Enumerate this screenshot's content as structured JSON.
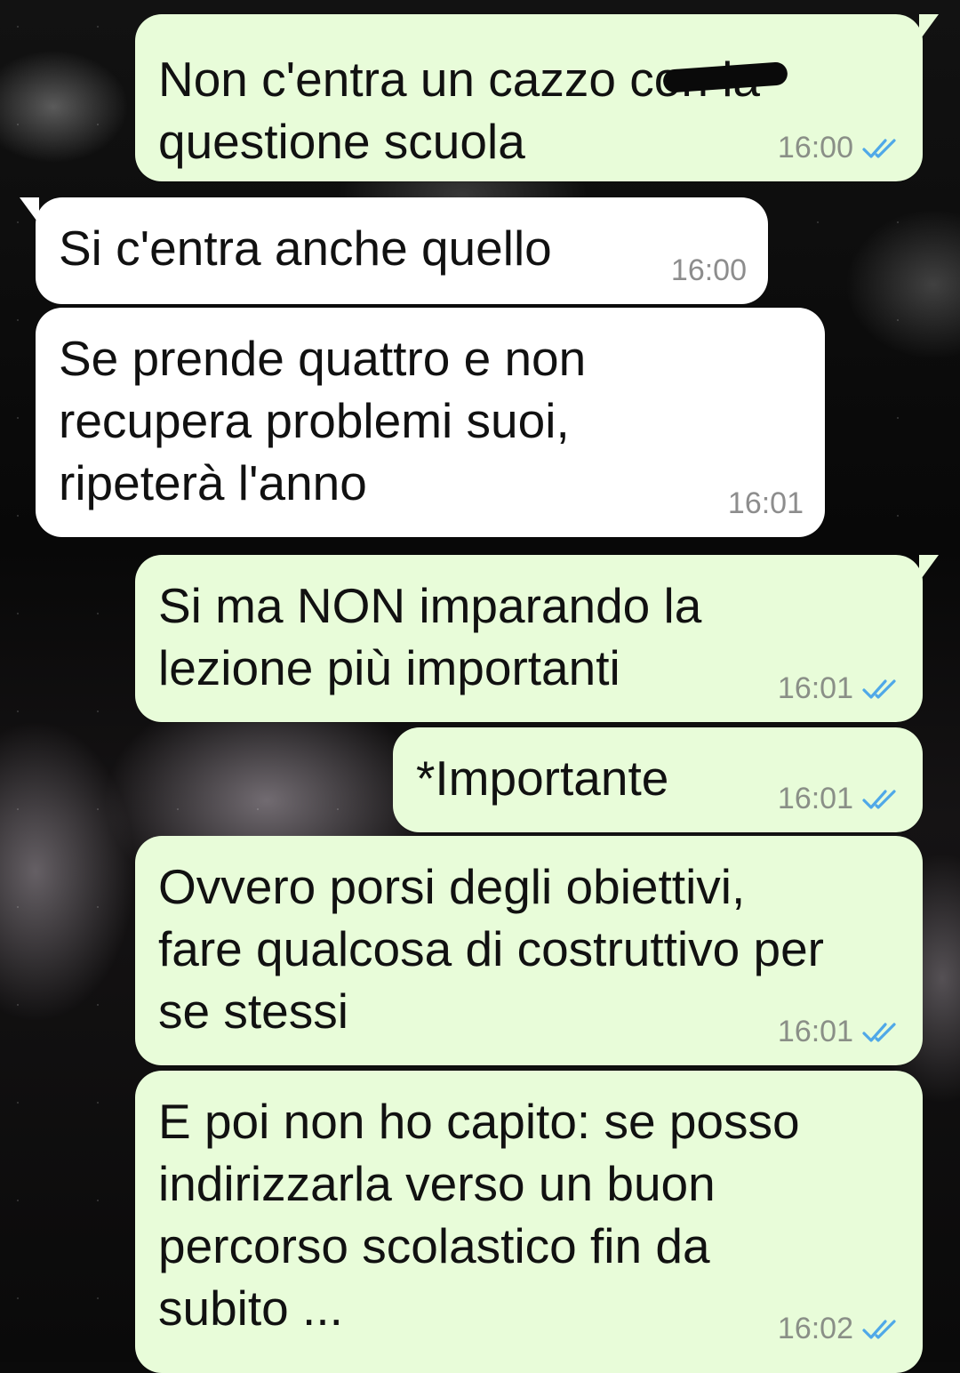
{
  "colors": {
    "outgoing_bubble": "#e8fcd9",
    "incoming_bubble": "#ffffff",
    "read_ticks": "#4fa8e8"
  },
  "messages": [
    {
      "direction": "outgoing",
      "text": "Non c'entra un cazzo con la\nquestione scuola",
      "time": "16:00",
      "status": "read"
    },
    {
      "direction": "incoming",
      "text": "Si c'entra anche quello",
      "time": "16:00"
    },
    {
      "direction": "incoming",
      "text": "Se prende quattro e non\nrecupera problemi suoi,\nripeterà l'anno",
      "time": "16:01"
    },
    {
      "direction": "outgoing",
      "text": "Si ma NON imparando la\nlezione più importanti",
      "time": "16:01",
      "status": "read"
    },
    {
      "direction": "outgoing",
      "text": "*Importante",
      "time": "16:01",
      "status": "read"
    },
    {
      "direction": "outgoing",
      "text": "Ovvero porsi degli obiettivi,\nfare qualcosa di costruttivo per\nse stessi",
      "time": "16:01",
      "status": "read"
    },
    {
      "direction": "outgoing",
      "text": "E poi non ho capito: se posso\nindirizzarla verso un buon\npercorso scolastico fin da\nsubito ...",
      "time": "16:02",
      "status": "read"
    }
  ]
}
